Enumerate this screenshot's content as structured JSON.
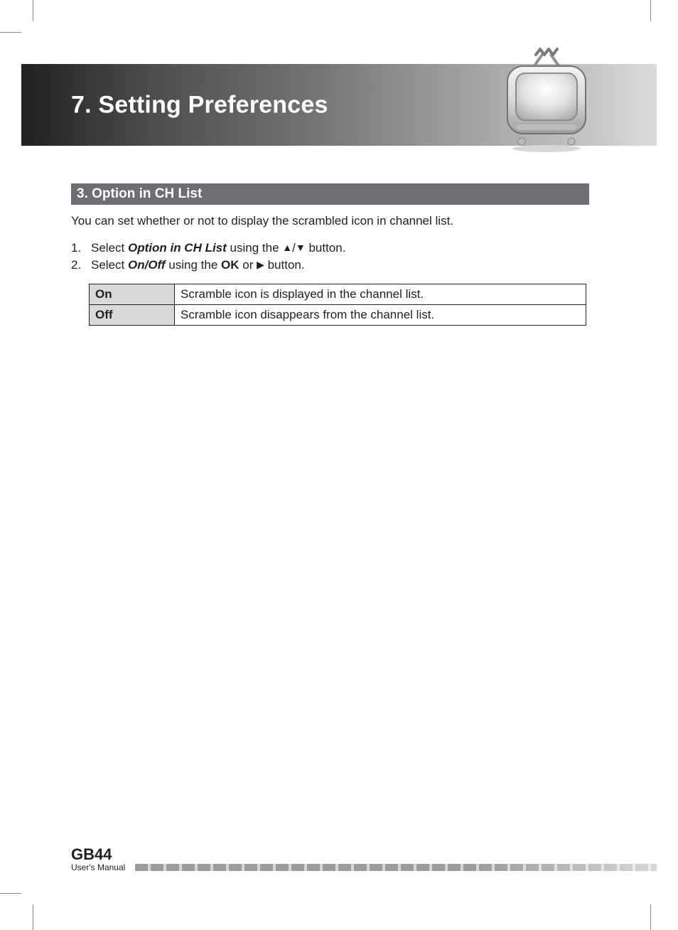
{
  "chapter": {
    "title": "7. Setting Preferences"
  },
  "section": {
    "title": "3. Option in CH List"
  },
  "intro": "You can set whether or not to display the scrambled icon in channel list.",
  "steps": {
    "s1": {
      "pre": "Select ",
      "em": "Option in CH List",
      "mid": " using the ",
      "up": "▲",
      "sep": "/",
      "down": "▼",
      "post": " button."
    },
    "s2": {
      "pre": "Select ",
      "em": "On/Off",
      "mid": " using the ",
      "ok": "OK",
      "or": " or ",
      "right": "▶",
      "post": " button."
    }
  },
  "table": {
    "on": {
      "key": "On",
      "desc": "Scramble icon is displayed in the channel list."
    },
    "off": {
      "key": "Off",
      "desc": "Scramble icon disappears from the channel list."
    }
  },
  "footer": {
    "page": "GB44",
    "label": "User's Manual"
  }
}
